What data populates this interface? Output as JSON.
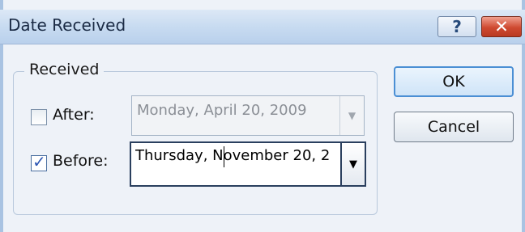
{
  "window": {
    "title": "Date Received",
    "help_glyph": "?",
    "close_glyph": "✕"
  },
  "group": {
    "label": "Received"
  },
  "after": {
    "checked": false,
    "label": "After:",
    "value": "Monday, April 20, 2009",
    "enabled": false
  },
  "before": {
    "checked": true,
    "check_glyph": "✓",
    "label": "Before:",
    "value": "Thursday, November 20, 2",
    "enabled": true
  },
  "buttons": {
    "ok": "OK",
    "cancel": "Cancel"
  },
  "icons": {
    "help": "help-icon",
    "close": "close-icon",
    "dropdown": "chevron-down-icon",
    "check": "checkmark-icon"
  },
  "colors": {
    "accent": "#4b8fd4",
    "close_red": "#cf4a31",
    "titlebar": "#c6daf0"
  }
}
